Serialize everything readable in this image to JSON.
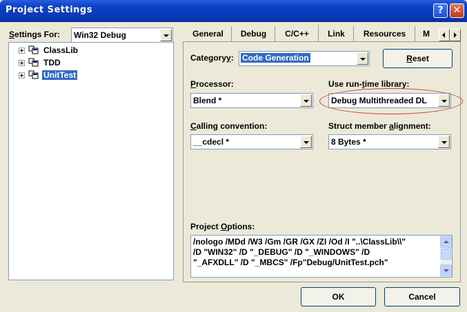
{
  "window": {
    "title": "Project Settings",
    "help_symbol": "?",
    "close_symbol": "✕"
  },
  "settings_for": {
    "label_key": "S",
    "label_rest": "ettings For:",
    "value": "Win32 Debug"
  },
  "tree": {
    "items": [
      {
        "label": "ClassLib",
        "selected": false
      },
      {
        "label": "TDD",
        "selected": false
      },
      {
        "label": "UnitTest",
        "selected": true
      }
    ]
  },
  "tabs": {
    "items": [
      "General",
      "Debug",
      "C/C++",
      "Link",
      "Resources",
      "M"
    ],
    "active": "C/C++"
  },
  "category": {
    "label_pre": "Category",
    "label_key": "y",
    "label_post": ":",
    "value": "Code Generation"
  },
  "reset_button": {
    "key": "R",
    "rest": "eset"
  },
  "processor": {
    "label_key": "P",
    "label_rest": "rocessor:",
    "value": "Blend *"
  },
  "runtime_library": {
    "label_pre": "Use run-",
    "label_key": "t",
    "label_post": "ime library:",
    "value": "Debug Multithreaded DL"
  },
  "calling_convention": {
    "label_key": "C",
    "label_rest": "alling convention:",
    "value": "__cdecl *"
  },
  "struct_alignment": {
    "label_pre": "Struct member ",
    "label_key": "a",
    "label_post": "lignment:",
    "value": "8 Bytes *"
  },
  "project_options": {
    "label_pre": "Project ",
    "label_key": "O",
    "label_post": "ptions:",
    "lines": [
      "/nologo /MDd /W3 /Gm /GR /GX /ZI /Od /I \"..\\ClassLib\\\\\"",
      "/D \"WIN32\" /D \"_DEBUG\" /D \"_WINDOWS\" /D",
      "\"_AFXDLL\" /D \"_MBCS\" /Fp\"Debug/UnitTest.pch\""
    ]
  },
  "buttons": {
    "ok": "OK",
    "cancel": "Cancel"
  }
}
